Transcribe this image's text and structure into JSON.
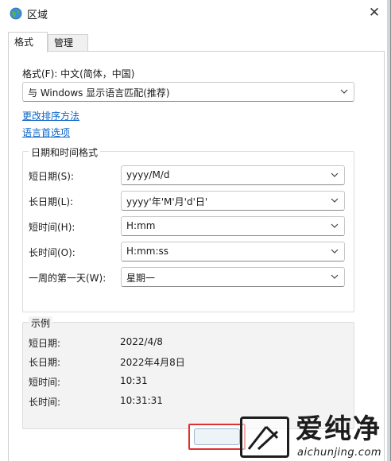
{
  "window": {
    "title": "区域",
    "close_glyph": "✕"
  },
  "tabs": [
    {
      "label": "格式",
      "active": true
    },
    {
      "label": "管理",
      "active": false
    }
  ],
  "format": {
    "label": "格式(F): 中文(简体，中国)",
    "selected": "与 Windows 显示语言匹配(推荐)"
  },
  "links": {
    "sort": "更改排序方法",
    "language": "语言首选项"
  },
  "datetime": {
    "group_title": "日期和时间格式",
    "rows": [
      {
        "label": "短日期(S):",
        "value": "yyyy/M/d"
      },
      {
        "label": "长日期(L):",
        "value": "yyyy'年'M'月'd'日'"
      },
      {
        "label": "短时间(H):",
        "value": "H:mm"
      },
      {
        "label": "长时间(O):",
        "value": "H:mm:ss"
      },
      {
        "label": "一周的第一天(W):",
        "value": "星期一"
      }
    ]
  },
  "example": {
    "group_title": "示例",
    "rows": [
      {
        "label": "短日期:",
        "value": "2022/4/8"
      },
      {
        "label": "长日期:",
        "value": "2022年4月8日"
      },
      {
        "label": "短时间:",
        "value": "10:31"
      },
      {
        "label": "长时间:",
        "value": "10:31:31"
      }
    ]
  },
  "watermark": {
    "cn": "爱纯净",
    "en": "aichunjing.com"
  },
  "colors": {
    "link": "#0a64c8",
    "highlight_border": "#e0312e",
    "example_bg": "#f3f3f3"
  },
  "icons": {
    "app": "globe-icon",
    "close": "close-icon",
    "dropdown": "chevron-down-icon"
  }
}
